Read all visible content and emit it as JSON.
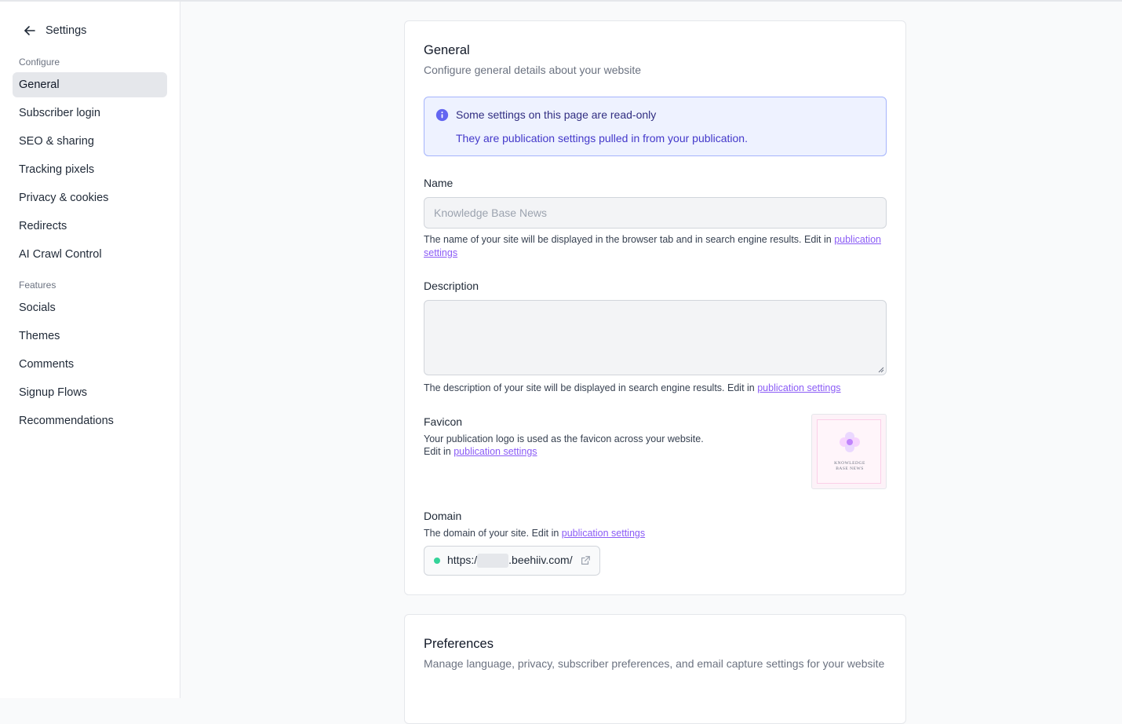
{
  "sidebar": {
    "back_title": "Settings",
    "configure_label": "Configure",
    "configure_items": [
      {
        "label": "General"
      },
      {
        "label": "Subscriber login"
      },
      {
        "label": "SEO & sharing"
      },
      {
        "label": "Tracking pixels"
      },
      {
        "label": "Privacy & cookies"
      },
      {
        "label": "Redirects"
      },
      {
        "label": "AI Crawl Control"
      }
    ],
    "features_label": "Features",
    "features_items": [
      {
        "label": "Socials"
      },
      {
        "label": "Themes"
      },
      {
        "label": "Comments"
      },
      {
        "label": "Signup Flows"
      },
      {
        "label": "Recommendations"
      }
    ],
    "active_item": "General"
  },
  "general": {
    "title": "General",
    "subtitle": "Configure general details about your website",
    "alert": {
      "title": "Some settings on this page are read-only",
      "body": "They are publication settings pulled in from your publication."
    },
    "name": {
      "label": "Name",
      "value": "Knowledge Base News",
      "help_prefix": "The name of your site will be displayed in the browser tab and in search engine results. Edit in ",
      "help_link": "publication settings"
    },
    "description": {
      "label": "Description",
      "value": "",
      "help_prefix": "The description of your site will be displayed in search engine results. Edit in ",
      "help_link": "publication settings"
    },
    "favicon": {
      "label": "Favicon",
      "help_line1": "Your publication logo is used as the favicon across your website.",
      "help_prefix": "Edit in ",
      "help_link": "publication settings",
      "logo_text_line1": "KNOWLEDGE",
      "logo_text_line2": "BASE NEWS"
    },
    "domain": {
      "label": "Domain",
      "help_prefix": "The domain of your site. Edit in ",
      "help_link": "publication settings",
      "url_prefix": "https:/",
      "url_suffix": ".beehiiv.com/",
      "status_color": "#34d399"
    }
  },
  "preferences": {
    "title": "Preferences",
    "subtitle": "Manage language, privacy, subscriber preferences, and email capture settings for your website"
  },
  "colors": {
    "accent_link": "#8b5cf6",
    "alert_bg": "#eef2ff",
    "alert_border": "#a5b4fc",
    "alert_icon": "#6366f1"
  }
}
